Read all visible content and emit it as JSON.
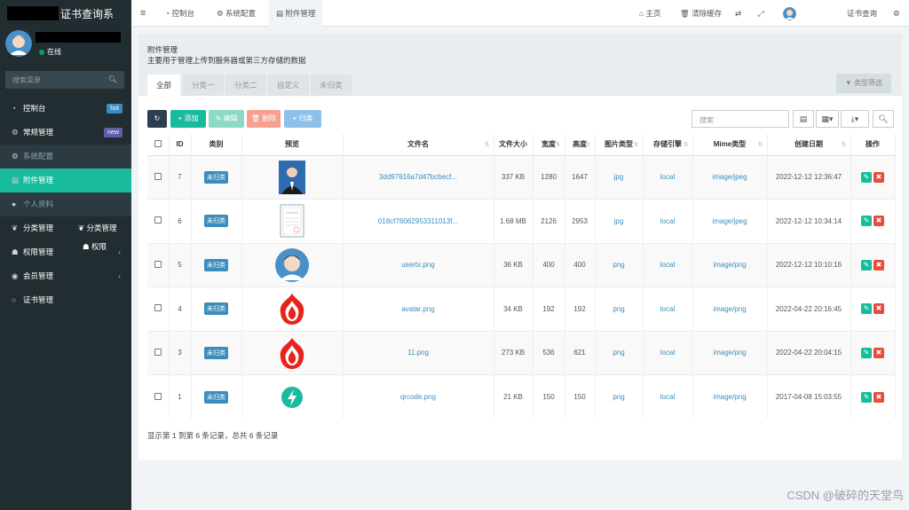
{
  "app": {
    "title": "证书查询系"
  },
  "user": {
    "status": "在线"
  },
  "sidebar": {
    "search_placeholder": "搜索菜单",
    "items": [
      {
        "label": "控制台",
        "badge": "hot"
      },
      {
        "label": "常规管理",
        "badge": "new"
      },
      {
        "label": "系统配置"
      },
      {
        "label": "附件管理"
      },
      {
        "label": "个人资料"
      },
      {
        "label": "分类管理"
      },
      {
        "label": "权限管理"
      },
      {
        "label": "会员管理"
      },
      {
        "label": "证书管理"
      }
    ],
    "overlay_labels": [
      "分类管理",
      "权限"
    ]
  },
  "topbar": {
    "tabs": [
      "控制台",
      "系统配置",
      "附件管理"
    ],
    "right": [
      "主页",
      "清除缓存",
      "证书查询"
    ]
  },
  "panel": {
    "title": "附件管理",
    "subtitle": "主要用于管理上传到服务器或第三方存储的数据",
    "tabs": [
      "全部",
      "分类一",
      "分类二",
      "自定义",
      "未归类"
    ],
    "filter_label": "类型筛选"
  },
  "toolbar": {
    "add": "添加",
    "edit": "编辑",
    "delete": "删除",
    "classify": "归类",
    "search_placeholder": "搜索"
  },
  "table": {
    "columns": [
      "ID",
      "类别",
      "预览",
      "文件名",
      "文件大小",
      "宽度",
      "高度",
      "图片类型",
      "存储引擎",
      "Mime类型",
      "创建日期",
      "操作"
    ],
    "rows": [
      {
        "id": "7",
        "category": "未归类",
        "thumb": "photo",
        "filename": "3dd97616a7d47bcbecf...",
        "size": "337 KB",
        "width": "1280",
        "height": "1647",
        "imgtype": "jpg",
        "storage": "local",
        "mime": "image/jpeg",
        "date": "2022-12-12 12:36:47"
      },
      {
        "id": "6",
        "category": "未归类",
        "thumb": "cert",
        "filename": "018cf76062953311013f...",
        "size": "1.68 MB",
        "width": "2126",
        "height": "2953",
        "imgtype": "jpg",
        "storage": "local",
        "mime": "image/jpeg",
        "date": "2022-12-12 10:34:14"
      },
      {
        "id": "5",
        "category": "未归类",
        "thumb": "avatar",
        "filename": "usertx.png",
        "size": "36 KB",
        "width": "400",
        "height": "400",
        "imgtype": "png",
        "storage": "local",
        "mime": "image/png",
        "date": "2022-12-12 10:10:16"
      },
      {
        "id": "4",
        "category": "未归类",
        "thumb": "flame",
        "filename": "avatar.png",
        "size": "34 KB",
        "width": "192",
        "height": "192",
        "imgtype": "png",
        "storage": "local",
        "mime": "image/png",
        "date": "2022-04-22 20:16:45"
      },
      {
        "id": "3",
        "category": "未归类",
        "thumb": "flame",
        "filename": "11.png",
        "size": "273 KB",
        "width": "536",
        "height": "621",
        "imgtype": "png",
        "storage": "local",
        "mime": "image/png",
        "date": "2022-04-22 20:04:15"
      },
      {
        "id": "1",
        "category": "未归类",
        "thumb": "bolt",
        "filename": "qrcode.png",
        "size": "21 KB",
        "width": "150",
        "height": "150",
        "imgtype": "png",
        "storage": "local",
        "mime": "image/png",
        "date": "2017-04-08 15:03:55"
      }
    ]
  },
  "footer": {
    "summary": "显示第 1 到第 6 条记录，总共 6 条记录"
  },
  "watermark": "CSDN @破碎的天堂鸟",
  "colors": {
    "sidebar": "#222d32",
    "accent": "#18bc9c",
    "badge_blue": "#3c8dbc",
    "danger": "#e74c3c"
  }
}
